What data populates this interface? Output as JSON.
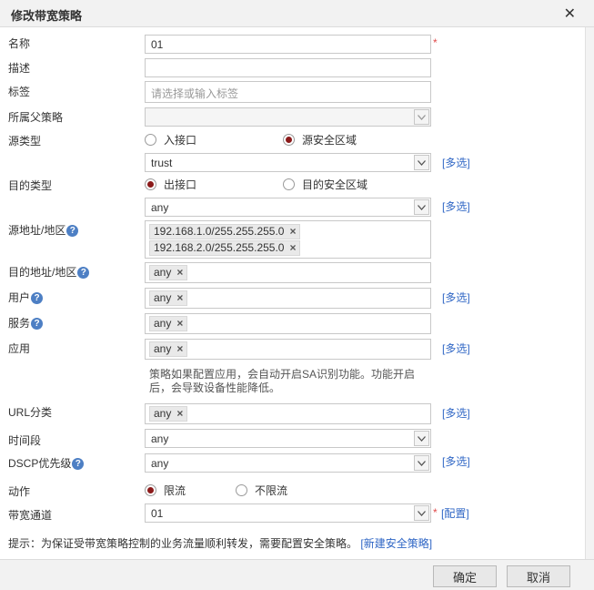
{
  "dialog": {
    "title": "修改带宽策略",
    "close_icon": "close-icon"
  },
  "form": {
    "name": {
      "label": "名称",
      "value": "01",
      "required": "*"
    },
    "desc": {
      "label": "描述",
      "value": ""
    },
    "tags": {
      "label": "标签",
      "placeholder": "请选择或输入标签"
    },
    "parent": {
      "label": "所属父策略",
      "value": ""
    },
    "source_type": {
      "label": "源类型",
      "options": [
        "入接口",
        "源安全区域"
      ],
      "selected": "源安全区域",
      "select_value": "trust",
      "multi_link": "[多选]"
    },
    "dest_type": {
      "label": "目的类型",
      "options": [
        "出接口",
        "目的安全区域"
      ],
      "selected": "出接口",
      "select_value": "any",
      "multi_link": "[多选]"
    },
    "src_addr": {
      "label": "源地址/地区",
      "tags": [
        "192.168.1.0/255.255.255.0",
        "192.168.2.0/255.255.255.0"
      ]
    },
    "dst_addr": {
      "label": "目的地址/地区",
      "tags": [
        "any"
      ]
    },
    "user": {
      "label": "用户",
      "tags": [
        "any"
      ],
      "multi_link": "[多选]"
    },
    "service": {
      "label": "服务",
      "tags": [
        "any"
      ]
    },
    "application": {
      "label": "应用",
      "tags": [
        "any"
      ],
      "multi_link": "[多选]",
      "note": "策略如果配置应用，会自动开启SA识别功能。功能开启后，会导致设备性能降低。"
    },
    "url": {
      "label": "URL分类",
      "tags": [
        "any"
      ],
      "multi_link": "[多选]"
    },
    "time": {
      "label": "时间段",
      "value": "any"
    },
    "dscp": {
      "label": "DSCP优先级",
      "value": "any",
      "multi_link": "[多选]"
    },
    "action": {
      "label": "动作",
      "options": [
        "限流",
        "不限流"
      ],
      "selected": "限流"
    },
    "channel": {
      "label": "带宽通道",
      "value": "01",
      "required": "*",
      "config_link": "[配置]"
    }
  },
  "hint": {
    "text": "提示：为保证受带宽策略控制的业务流量顺利转发，需要配置安全策略。",
    "link": "[新建安全策略]"
  },
  "buttons": {
    "ok": "确定",
    "cancel": "取消"
  },
  "help_icon": "?",
  "remove_icon": "×"
}
